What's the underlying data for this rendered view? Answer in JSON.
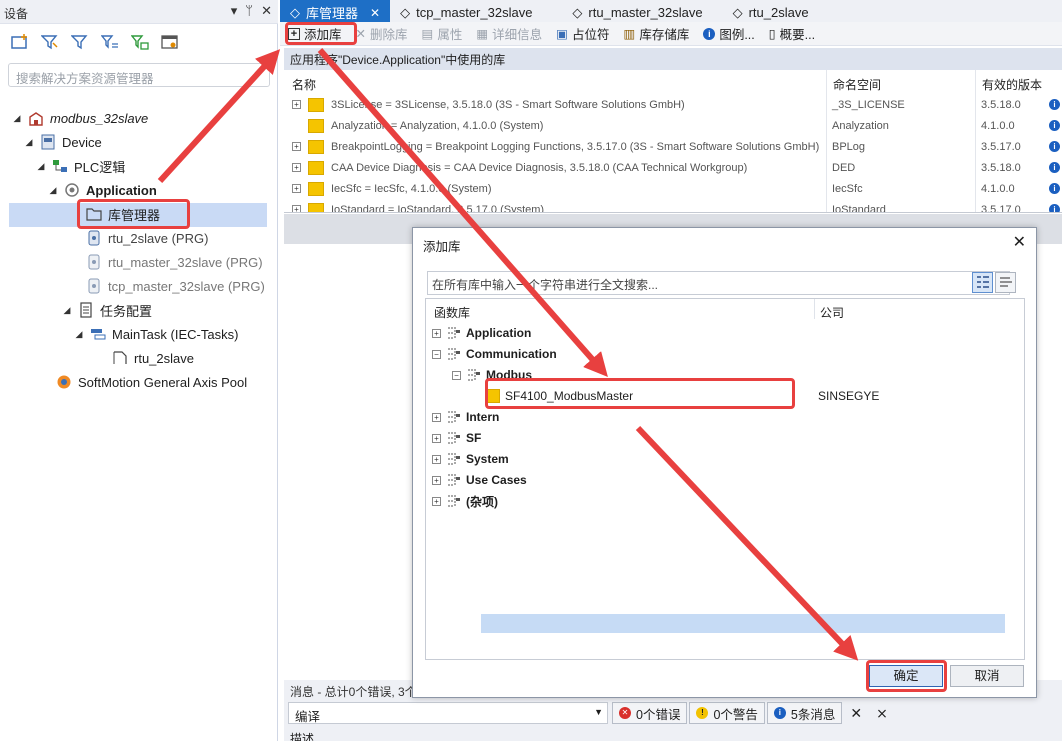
{
  "left_panel": {
    "title": "设备",
    "search_placeholder": "搜索解决方案资源管理器",
    "tree": {
      "project": "modbus_32slave",
      "device": "Device",
      "plc_logic": "PLC逻辑",
      "application": "Application",
      "library_manager": "库管理器",
      "rtu_2slave_prg": "rtu_2slave (PRG)",
      "rtu_master_prg": "rtu_master_32slave (PRG)",
      "tcp_master_prg": "tcp_master_32slave (PRG)",
      "task_config": "任务配置",
      "main_task": "MainTask (IEC-Tasks)",
      "rtu_2slave_task": "rtu_2slave",
      "softmotion": "SoftMotion General Axis Pool"
    }
  },
  "tabs": [
    {
      "label": "库管理器"
    },
    {
      "label": "tcp_master_32slave"
    },
    {
      "label": "rtu_master_32slave"
    },
    {
      "label": "rtu_2slave"
    }
  ],
  "lib_toolbar": {
    "add_library": "添加库",
    "delete_library": "删除库",
    "properties": "属性",
    "details": "详细信息",
    "placeholder": "占位符",
    "repository": "库存储库",
    "icons": "图例...",
    "summary": "概要..."
  },
  "app_header": "应用程序\"Device.Application\"中使用的库",
  "lib_table": {
    "headers": {
      "name": "名称",
      "namespace": "命名空间",
      "version": "有效的版本"
    },
    "rows": [
      {
        "name": "3SLicense = 3SLicense, 3.5.18.0 (3S - Smart Software Solutions GmbH)",
        "namespace": "_3S_LICENSE",
        "version": "3.5.18.0",
        "expandable": true
      },
      {
        "name": "Analyzation = Analyzation, 4.1.0.0 (System)",
        "namespace": "Analyzation",
        "version": "4.1.0.0",
        "expandable": false
      },
      {
        "name": "BreakpointLogging = Breakpoint Logging Functions, 3.5.17.0 (3S - Smart Software Solutions GmbH)",
        "namespace": "BPLog",
        "version": "3.5.17.0",
        "expandable": true
      },
      {
        "name": "CAA Device Diagnosis = CAA Device Diagnosis, 3.5.18.0 (CAA Technical Workgroup)",
        "namespace": "DED",
        "version": "3.5.18.0",
        "expandable": true
      },
      {
        "name": "IecSfc = IecSfc, 4.1.0.0 (System)",
        "namespace": "IecSfc",
        "version": "4.1.0.0",
        "expandable": true
      },
      {
        "name": "IoStandard = IoStandard, 3.5.17.0 (System)",
        "namespace": "IoStandard",
        "version": "3.5.17.0",
        "expandable": true
      }
    ]
  },
  "messages": {
    "summary": "消息 - 总计0个错误, 3个",
    "category": "编译",
    "errors": "0个错误",
    "warnings": "0个警告",
    "infos": "5条消息",
    "description_label": "描述"
  },
  "dialog": {
    "title": "添加库",
    "search_placeholder": "在所有库中输入一个字符串进行全文搜索...",
    "col_library": "函数库",
    "col_company": "公司",
    "tree": {
      "application": "Application",
      "communication": "Communication",
      "modbus": "Modbus",
      "selected_lib": "SF4100_ModbusMaster",
      "selected_company": "SINSEGYE",
      "intern": "Intern",
      "sf": "SF",
      "system": "System",
      "use_cases": "Use Cases",
      "misc": "(杂项)"
    },
    "ok_label": "确定",
    "cancel_label": "取消"
  },
  "colors": {
    "accent": "#1e6fc6",
    "annotation_red": "#e8403f",
    "selection": "#c9daf5",
    "folder_yellow": "#f5c400"
  }
}
